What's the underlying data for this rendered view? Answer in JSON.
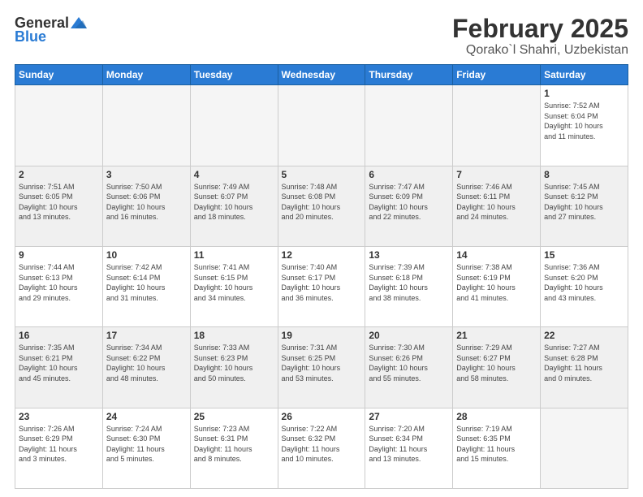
{
  "header": {
    "logo": {
      "line1": "General",
      "line2": "Blue"
    },
    "title": "February 2025",
    "location": "Qorako`l Shahri, Uzbekistan"
  },
  "days_of_week": [
    "Sunday",
    "Monday",
    "Tuesday",
    "Wednesday",
    "Thursday",
    "Friday",
    "Saturday"
  ],
  "weeks": [
    [
      {
        "day": "",
        "info": ""
      },
      {
        "day": "",
        "info": ""
      },
      {
        "day": "",
        "info": ""
      },
      {
        "day": "",
        "info": ""
      },
      {
        "day": "",
        "info": ""
      },
      {
        "day": "",
        "info": ""
      },
      {
        "day": "1",
        "info": "Sunrise: 7:52 AM\nSunset: 6:04 PM\nDaylight: 10 hours\nand 11 minutes."
      }
    ],
    [
      {
        "day": "2",
        "info": "Sunrise: 7:51 AM\nSunset: 6:05 PM\nDaylight: 10 hours\nand 13 minutes."
      },
      {
        "day": "3",
        "info": "Sunrise: 7:50 AM\nSunset: 6:06 PM\nDaylight: 10 hours\nand 16 minutes."
      },
      {
        "day": "4",
        "info": "Sunrise: 7:49 AM\nSunset: 6:07 PM\nDaylight: 10 hours\nand 18 minutes."
      },
      {
        "day": "5",
        "info": "Sunrise: 7:48 AM\nSunset: 6:08 PM\nDaylight: 10 hours\nand 20 minutes."
      },
      {
        "day": "6",
        "info": "Sunrise: 7:47 AM\nSunset: 6:09 PM\nDaylight: 10 hours\nand 22 minutes."
      },
      {
        "day": "7",
        "info": "Sunrise: 7:46 AM\nSunset: 6:11 PM\nDaylight: 10 hours\nand 24 minutes."
      },
      {
        "day": "8",
        "info": "Sunrise: 7:45 AM\nSunset: 6:12 PM\nDaylight: 10 hours\nand 27 minutes."
      }
    ],
    [
      {
        "day": "9",
        "info": "Sunrise: 7:44 AM\nSunset: 6:13 PM\nDaylight: 10 hours\nand 29 minutes."
      },
      {
        "day": "10",
        "info": "Sunrise: 7:42 AM\nSunset: 6:14 PM\nDaylight: 10 hours\nand 31 minutes."
      },
      {
        "day": "11",
        "info": "Sunrise: 7:41 AM\nSunset: 6:15 PM\nDaylight: 10 hours\nand 34 minutes."
      },
      {
        "day": "12",
        "info": "Sunrise: 7:40 AM\nSunset: 6:17 PM\nDaylight: 10 hours\nand 36 minutes."
      },
      {
        "day": "13",
        "info": "Sunrise: 7:39 AM\nSunset: 6:18 PM\nDaylight: 10 hours\nand 38 minutes."
      },
      {
        "day": "14",
        "info": "Sunrise: 7:38 AM\nSunset: 6:19 PM\nDaylight: 10 hours\nand 41 minutes."
      },
      {
        "day": "15",
        "info": "Sunrise: 7:36 AM\nSunset: 6:20 PM\nDaylight: 10 hours\nand 43 minutes."
      }
    ],
    [
      {
        "day": "16",
        "info": "Sunrise: 7:35 AM\nSunset: 6:21 PM\nDaylight: 10 hours\nand 45 minutes."
      },
      {
        "day": "17",
        "info": "Sunrise: 7:34 AM\nSunset: 6:22 PM\nDaylight: 10 hours\nand 48 minutes."
      },
      {
        "day": "18",
        "info": "Sunrise: 7:33 AM\nSunset: 6:23 PM\nDaylight: 10 hours\nand 50 minutes."
      },
      {
        "day": "19",
        "info": "Sunrise: 7:31 AM\nSunset: 6:25 PM\nDaylight: 10 hours\nand 53 minutes."
      },
      {
        "day": "20",
        "info": "Sunrise: 7:30 AM\nSunset: 6:26 PM\nDaylight: 10 hours\nand 55 minutes."
      },
      {
        "day": "21",
        "info": "Sunrise: 7:29 AM\nSunset: 6:27 PM\nDaylight: 10 hours\nand 58 minutes."
      },
      {
        "day": "22",
        "info": "Sunrise: 7:27 AM\nSunset: 6:28 PM\nDaylight: 11 hours\nand 0 minutes."
      }
    ],
    [
      {
        "day": "23",
        "info": "Sunrise: 7:26 AM\nSunset: 6:29 PM\nDaylight: 11 hours\nand 3 minutes."
      },
      {
        "day": "24",
        "info": "Sunrise: 7:24 AM\nSunset: 6:30 PM\nDaylight: 11 hours\nand 5 minutes."
      },
      {
        "day": "25",
        "info": "Sunrise: 7:23 AM\nSunset: 6:31 PM\nDaylight: 11 hours\nand 8 minutes."
      },
      {
        "day": "26",
        "info": "Sunrise: 7:22 AM\nSunset: 6:32 PM\nDaylight: 11 hours\nand 10 minutes."
      },
      {
        "day": "27",
        "info": "Sunrise: 7:20 AM\nSunset: 6:34 PM\nDaylight: 11 hours\nand 13 minutes."
      },
      {
        "day": "28",
        "info": "Sunrise: 7:19 AM\nSunset: 6:35 PM\nDaylight: 11 hours\nand 15 minutes."
      },
      {
        "day": "",
        "info": ""
      }
    ]
  ]
}
